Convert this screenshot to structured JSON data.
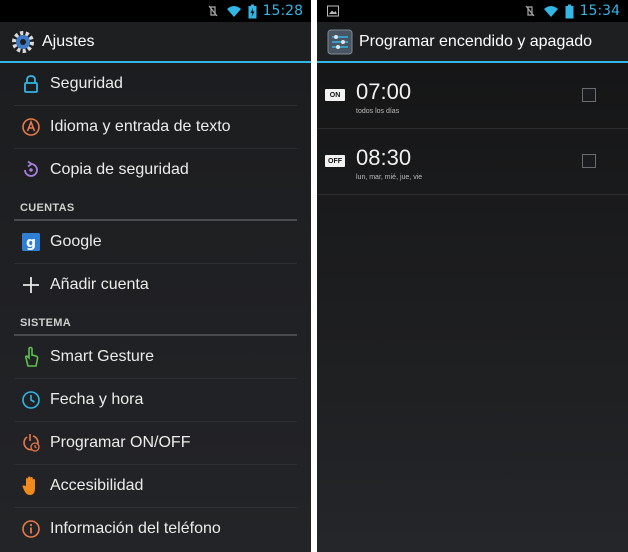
{
  "left": {
    "status_time": "15:28",
    "title": "Ajustes",
    "items_top": [
      {
        "label": "Seguridad",
        "icon": "lock-icon"
      },
      {
        "label": "Idioma y entrada de texto",
        "icon": "language-icon"
      },
      {
        "label": "Copia de seguridad",
        "icon": "backup-icon"
      }
    ],
    "header_cuentas": "CUENTAS",
    "items_cuentas": [
      {
        "label": "Google",
        "icon": "google-icon"
      },
      {
        "label": "Añadir cuenta",
        "icon": "plus-icon"
      }
    ],
    "header_sistema": "SISTEMA",
    "items_sistema": [
      {
        "label": "Smart Gesture",
        "icon": "hand-pointer-icon"
      },
      {
        "label": "Fecha y hora",
        "icon": "clock-icon"
      },
      {
        "label": "Programar ON/OFF",
        "icon": "power-clock-icon"
      },
      {
        "label": "Accesibilidad",
        "icon": "hand-icon"
      },
      {
        "label": "Información del teléfono",
        "icon": "info-icon"
      }
    ]
  },
  "right": {
    "status_time": "15:34",
    "title": "Programar encendido y apagado",
    "schedules": [
      {
        "badge": "ON",
        "time": "07:00",
        "days": "todos los días",
        "checked": false
      },
      {
        "badge": "OFF",
        "time": "08:30",
        "days": "lun, mar, mié, jue, vie",
        "checked": false
      }
    ]
  },
  "colors": {
    "accent": "#33b5e5",
    "background": "#1b1c1e"
  }
}
